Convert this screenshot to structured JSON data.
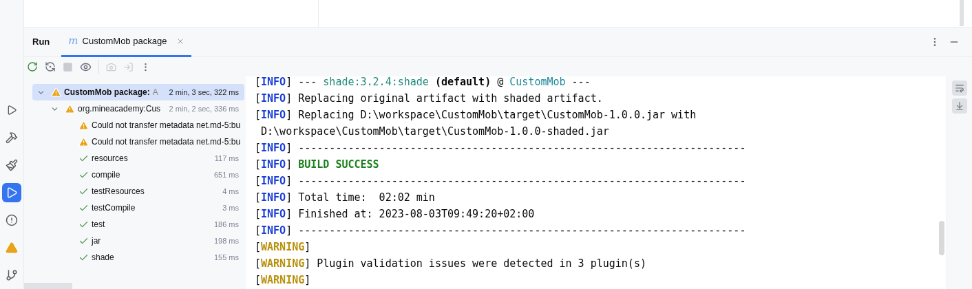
{
  "tool_window": {
    "title": "Run",
    "tabs": [
      {
        "icon": "m",
        "label": "CustomMob package",
        "selected": true
      }
    ]
  },
  "left_toolbar": [
    {
      "kind": "services",
      "selected": false
    },
    {
      "kind": "build",
      "selected": false
    },
    {
      "kind": "maven",
      "selected": false
    },
    {
      "kind": "run",
      "selected": true
    },
    {
      "kind": "problems",
      "selected": false
    },
    {
      "kind": "warning",
      "selected": false
    },
    {
      "kind": "git",
      "selected": false
    }
  ],
  "run_tree": [
    {
      "label": "CustomMob package:",
      "suffix": "A",
      "time": "2 min, 3 sec, 322 ms",
      "kind": "warning",
      "selected": true,
      "expanded": true,
      "children": [
        {
          "label": "org.mineacademy:Cus",
          "time": "2 min, 2 sec, 336 ms",
          "kind": "warning",
          "selected": false,
          "expanded": true,
          "children": [
            {
              "label": "Could not transfer metadata net.md-5:bu",
              "kind": "warning",
              "selected": false
            },
            {
              "label": "Could not transfer metadata net.md-5:bu",
              "kind": "warning",
              "selected": false
            },
            {
              "label": "resources",
              "time": "117 ms",
              "kind": "success",
              "selected": false
            },
            {
              "label": "compile",
              "time": "651 ms",
              "kind": "success",
              "selected": false
            },
            {
              "label": "testResources",
              "time": "4 ms",
              "kind": "success",
              "selected": false
            },
            {
              "label": "testCompile",
              "time": "3 ms",
              "kind": "success",
              "selected": false
            },
            {
              "label": "test",
              "time": "186 ms",
              "kind": "success",
              "selected": false
            },
            {
              "label": "jar",
              "time": "198 ms",
              "kind": "success",
              "selected": false
            },
            {
              "label": "shade",
              "time": "155 ms",
              "kind": "success",
              "selected": false
            }
          ]
        }
      ]
    }
  ],
  "console": [
    [
      {
        "text": "[",
        "kind": "plain"
      },
      {
        "text": "INFO",
        "kind": "info"
      },
      {
        "text": "] --- ",
        "kind": "plain"
      },
      {
        "text": "shade:3.2.4:shade",
        "kind": "goal"
      },
      {
        "text": " (default)",
        "kind": "bold"
      },
      {
        "text": " @ ",
        "kind": "plain"
      },
      {
        "text": "CustomMob",
        "kind": "project"
      },
      {
        "text": " ---",
        "kind": "plain"
      }
    ],
    [
      {
        "text": "[",
        "kind": "plain"
      },
      {
        "text": "INFO",
        "kind": "info"
      },
      {
        "text": "] Replacing original artifact with shaded artifact.",
        "kind": "plain"
      }
    ],
    [
      {
        "text": "[",
        "kind": "plain"
      },
      {
        "text": "INFO",
        "kind": "info"
      },
      {
        "text": "] Replacing D:\\workspace\\CustomMob\\target\\CustomMob-1.0.0.jar with",
        "kind": "plain"
      }
    ],
    [
      {
        "text": " D:\\workspace\\CustomMob\\target\\CustomMob-1.0.0-shaded.jar",
        "kind": "plain"
      }
    ],
    [
      {
        "text": "[",
        "kind": "plain"
      },
      {
        "text": "INFO",
        "kind": "info"
      },
      {
        "text": "] ------------------------------------------------------------------------",
        "kind": "plain"
      }
    ],
    [
      {
        "text": "[",
        "kind": "plain"
      },
      {
        "text": "INFO",
        "kind": "info"
      },
      {
        "text": "] ",
        "kind": "plain"
      },
      {
        "text": "BUILD SUCCESS",
        "kind": "success"
      }
    ],
    [
      {
        "text": "[",
        "kind": "plain"
      },
      {
        "text": "INFO",
        "kind": "info"
      },
      {
        "text": "] ------------------------------------------------------------------------",
        "kind": "plain"
      }
    ],
    [
      {
        "text": "[",
        "kind": "plain"
      },
      {
        "text": "INFO",
        "kind": "info"
      },
      {
        "text": "] Total time:  02:02 min",
        "kind": "plain"
      }
    ],
    [
      {
        "text": "[",
        "kind": "plain"
      },
      {
        "text": "INFO",
        "kind": "info"
      },
      {
        "text": "] Finished at: 2023-08-03T09:49:20+02:00",
        "kind": "plain"
      }
    ],
    [
      {
        "text": "[",
        "kind": "plain"
      },
      {
        "text": "INFO",
        "kind": "info"
      },
      {
        "text": "] ------------------------------------------------------------------------",
        "kind": "plain"
      }
    ],
    [
      {
        "text": "[",
        "kind": "plain"
      },
      {
        "text": "WARNING",
        "kind": "warning"
      },
      {
        "text": "]",
        "kind": "plain"
      }
    ],
    [
      {
        "text": "[",
        "kind": "plain"
      },
      {
        "text": "WARNING",
        "kind": "warning"
      },
      {
        "text": "] Plugin validation issues were detected in 3 plugin(s)",
        "kind": "plain"
      }
    ],
    [
      {
        "text": "[",
        "kind": "plain"
      },
      {
        "text": "WARNING",
        "kind": "warning"
      },
      {
        "text": "]",
        "kind": "plain"
      }
    ]
  ]
}
